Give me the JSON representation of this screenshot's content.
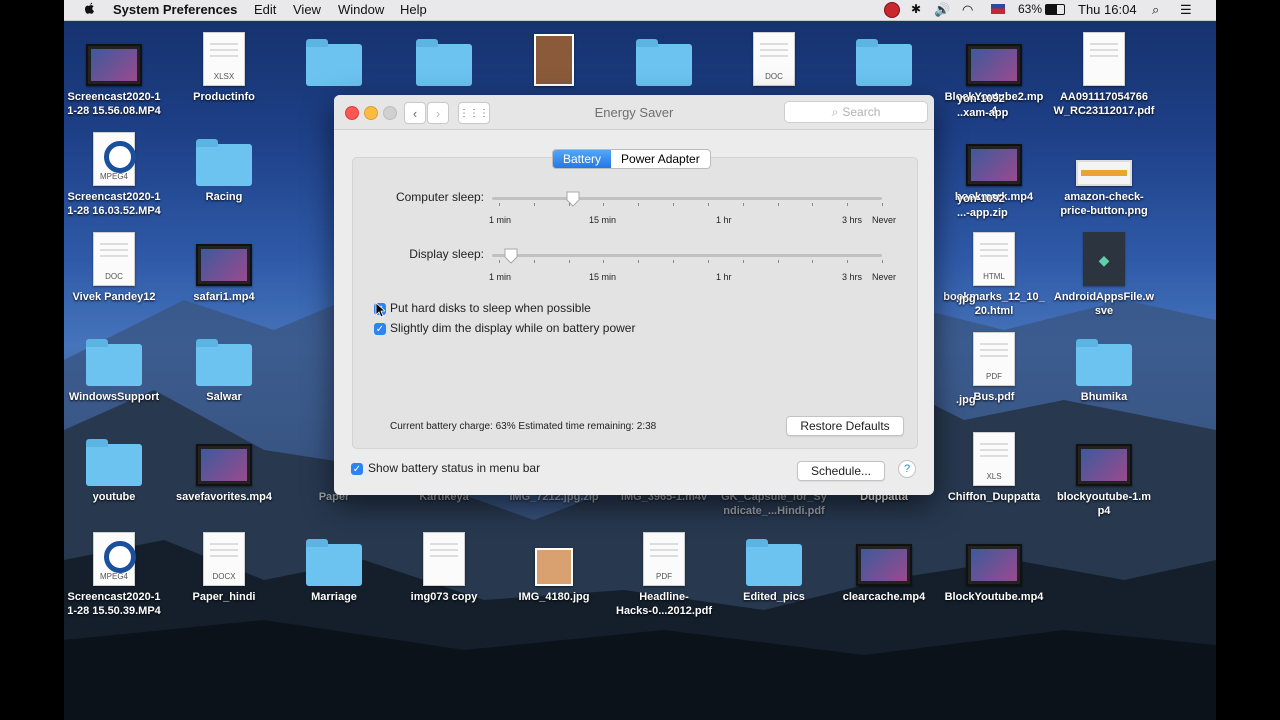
{
  "menubar": {
    "app_name": "System Preferences",
    "items": [
      "Edit",
      "View",
      "Window",
      "Help"
    ],
    "battery_percent": "63%",
    "clock": "Thu 16:04"
  },
  "desktop_icons": [
    {
      "label": "Screencast2020-1\n1-28 15.56.08.MP4",
      "type": "video"
    },
    {
      "label": "Productinfo",
      "type": "doc",
      "ext": "XLSX"
    },
    {
      "label": "",
      "type": "folder"
    },
    {
      "label": "",
      "type": "folder"
    },
    {
      "label": "",
      "type": "image"
    },
    {
      "label": "",
      "type": "folder"
    },
    {
      "label": "",
      "type": "doc",
      "ext": "DOC"
    },
    {
      "label": "",
      "type": "folder"
    },
    {
      "label": "BlockYoutube2.mp\n4",
      "type": "video"
    },
    {
      "label": "AA091117054766\nW_RC23112017.pdf",
      "type": "doc",
      "ext": ""
    },
    {
      "label": "Screencast2020-1\n1-28 16.03.52.MP4",
      "type": "mpeg4"
    },
    {
      "label": "Racing",
      "type": "folder"
    },
    {
      "label": "Vivek Pandey12",
      "type": "doc",
      "ext": "DOC"
    },
    {
      "label": "safari1.mp4",
      "type": "video"
    },
    {
      "label": "bookmark.mp4",
      "type": "video"
    },
    {
      "label": "amazon-check-\nprice-button.png",
      "type": "png"
    },
    {
      "label": "bookmarks_12_10_\n20.html",
      "type": "doc",
      "ext": "HTML"
    },
    {
      "label": "AndroidAppsFile.w\nsve",
      "type": "app"
    },
    {
      "label": "WindowsSupport",
      "type": "folder"
    },
    {
      "label": "Salwar",
      "type": "folder"
    },
    {
      "label": "Bus.pdf",
      "type": "doc",
      "ext": "PDF"
    },
    {
      "label": "Bhumika",
      "type": "folder"
    },
    {
      "label": "youtube",
      "type": "folder"
    },
    {
      "label": "savefavorites.mp4",
      "type": "video"
    },
    {
      "label": "Paper",
      "type": "hidden"
    },
    {
      "label": "Kartikeya",
      "type": "hidden"
    },
    {
      "label": "IMG_7212.jpg.zip",
      "type": "hidden"
    },
    {
      "label": "IMG_3965-1.m4v",
      "type": "hidden"
    },
    {
      "label": "GK_Capsule_for_Sy\nndicate_...Hindi.pdf",
      "type": "hidden"
    },
    {
      "label": "Duppatta",
      "type": "folder"
    },
    {
      "label": "Chiffon_Duppatta",
      "type": "doc",
      "ext": "XLS"
    },
    {
      "label": "blockyoutube-1.m\np4",
      "type": "video"
    },
    {
      "label": "Screencast2020-1\n1-28 15.50.39.MP4",
      "type": "mpeg4"
    },
    {
      "label": "Paper_hindi",
      "type": "doc",
      "ext": "DOCX"
    },
    {
      "label": "Marriage",
      "type": "folder"
    },
    {
      "label": "img073 copy",
      "type": "doc",
      "ext": ""
    },
    {
      "label": "IMG_4180.jpg",
      "type": "photo"
    },
    {
      "label": "Headline-\nHacks-0...2012.pdf",
      "type": "doc",
      "ext": "PDF"
    },
    {
      "label": "Edited_pics",
      "type": "folder"
    },
    {
      "label": "clearcache.mp4",
      "type": "video"
    },
    {
      "label": "BlockYoutube.mp4",
      "type": "video"
    }
  ],
  "partial_labels": [
    "yon-1092\n..xam-app",
    "yon-1092\n...-app.zip",
    ".jpg",
    ".jpg"
  ],
  "window": {
    "title": "Energy Saver",
    "search_placeholder": "Search",
    "tabs": [
      "Battery",
      "Power Adapter"
    ],
    "active_tab": "Battery",
    "computer_sleep_label": "Computer sleep:",
    "display_sleep_label": "Display sleep:",
    "slider_ticks": [
      "1 min",
      "15 min",
      "1 hr",
      "3 hrs",
      "Never"
    ],
    "computer_sleep_value": "15 min",
    "display_sleep_value": "1 min",
    "checkboxes": [
      {
        "label": "Put hard disks to sleep when possible",
        "checked": true
      },
      {
        "label": "Slightly dim the display while on battery power",
        "checked": true
      }
    ],
    "status_text": "Current battery charge: 63%  Estimated time remaining: 2:38",
    "restore_button": "Restore Defaults",
    "show_battery_label": "Show battery status in menu bar",
    "show_battery_checked": true,
    "schedule_button": "Schedule...",
    "help_button": "?"
  },
  "colors": {
    "accent": "#2b84ef",
    "folder": "#6cc3ef"
  }
}
